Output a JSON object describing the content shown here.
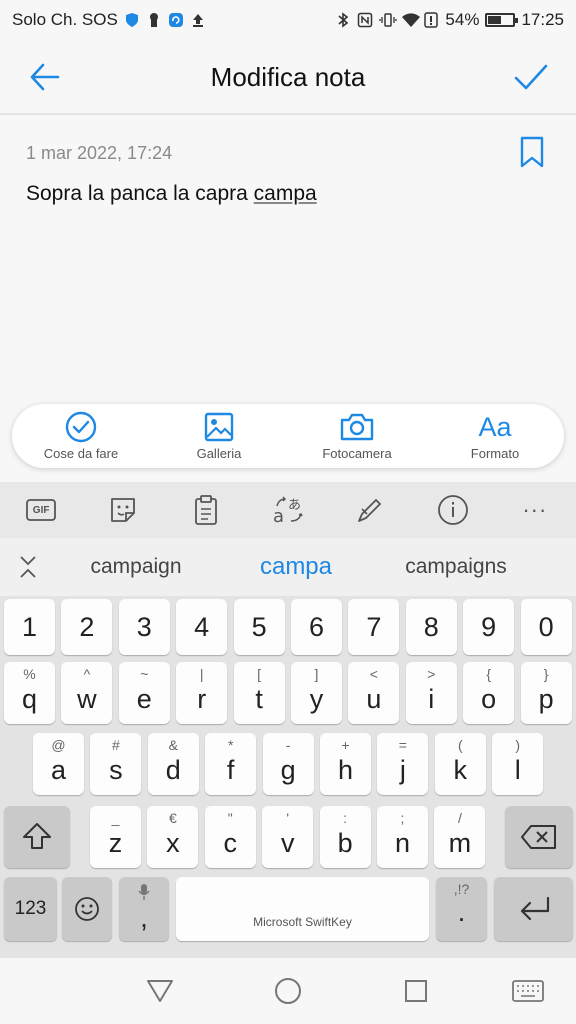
{
  "status": {
    "carrier": "Solo Ch. SOS",
    "battery": "54%",
    "battery_level": 0.54,
    "time": "17:25"
  },
  "header": {
    "title": "Modifica nota"
  },
  "note": {
    "date": "1 mar 2022, 17:24",
    "text_plain": "Sopra la panca la capra ",
    "text_underlined": "campa"
  },
  "actions": [
    {
      "label": "Cose da fare",
      "icon": "checklist-icon"
    },
    {
      "label": "Galleria",
      "icon": "image-icon"
    },
    {
      "label": "Fotocamera",
      "icon": "camera-icon"
    },
    {
      "label": "Formato",
      "icon": "text-format-icon",
      "glyph": "Aa"
    }
  ],
  "keyboard": {
    "toolbar": [
      "gif-icon",
      "sticker-icon",
      "clipboard-icon",
      "translate-icon",
      "pen-icon",
      "info-icon",
      "more-icon"
    ],
    "gif_label": "GIF",
    "more_glyph": "···",
    "suggestions": [
      "campaign",
      "campa",
      "campaigns"
    ],
    "numbers": [
      "1",
      "2",
      "3",
      "4",
      "5",
      "6",
      "7",
      "8",
      "9",
      "0"
    ],
    "row1": [
      {
        "k": "q",
        "s": "%"
      },
      {
        "k": "w",
        "s": "^"
      },
      {
        "k": "e",
        "s": "~"
      },
      {
        "k": "r",
        "s": "|"
      },
      {
        "k": "t",
        "s": "["
      },
      {
        "k": "y",
        "s": "]"
      },
      {
        "k": "u",
        "s": "<"
      },
      {
        "k": "i",
        "s": ">"
      },
      {
        "k": "o",
        "s": "{"
      },
      {
        "k": "p",
        "s": "}"
      }
    ],
    "row2": [
      {
        "k": "a",
        "s": "@"
      },
      {
        "k": "s",
        "s": "#"
      },
      {
        "k": "d",
        "s": "&"
      },
      {
        "k": "f",
        "s": "*"
      },
      {
        "k": "g",
        "s": "-"
      },
      {
        "k": "h",
        "s": "+"
      },
      {
        "k": "j",
        "s": "="
      },
      {
        "k": "k",
        "s": "("
      },
      {
        "k": "l",
        "s": ")"
      }
    ],
    "row3": [
      {
        "k": "z",
        "s": "_"
      },
      {
        "k": "x",
        "s": "€"
      },
      {
        "k": "c",
        "s": "\""
      },
      {
        "k": "v",
        "s": "'"
      },
      {
        "k": "b",
        "s": ":"
      },
      {
        "k": "n",
        "s": ";"
      },
      {
        "k": "m",
        "s": "/"
      }
    ],
    "numbers_key": "123",
    "comma_key": ",",
    "space_label": "Microsoft SwiftKey",
    "period_key": ".",
    "period_sub": ",!?",
    "accent_color": "#1e88e5"
  }
}
